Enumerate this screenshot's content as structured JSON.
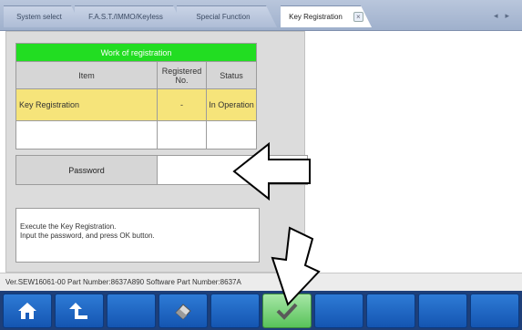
{
  "tabs": [
    {
      "label": "System select"
    },
    {
      "label": "F.A.S.T./IMMO/Keyless"
    },
    {
      "label": "Special Function"
    },
    {
      "label": "Key Registration",
      "close": "×"
    }
  ],
  "nav": {
    "prev": "◂",
    "next": "▸"
  },
  "work_table": {
    "title": "Work of registration",
    "headers": [
      "Item",
      "Registered No.",
      "Status"
    ],
    "rows": [
      {
        "item": "Key Registration",
        "registered_no": "-",
        "status": "In Operation"
      },
      {
        "item": "",
        "registered_no": "",
        "status": ""
      }
    ]
  },
  "password": {
    "label": "Password",
    "value": ""
  },
  "message": {
    "line1": "Execute the Key Registration.",
    "line2": "Input the password, and press OK button."
  },
  "status_bar": {
    "text": "Ver.SEW16061-00 Part Number:8637A890   Software Part Number:8637A"
  },
  "toolbar": {
    "buttons": [
      {
        "icon": "home-icon"
      },
      {
        "icon": "back-icon"
      },
      {
        "icon": ""
      },
      {
        "icon": "eraser-icon"
      },
      {
        "icon": ""
      },
      {
        "icon": "ok-check-icon"
      },
      {
        "icon": ""
      },
      {
        "icon": ""
      },
      {
        "icon": ""
      },
      {
        "icon": ""
      }
    ]
  },
  "colors": {
    "header_green": "#22dd22",
    "active_row_yellow": "#f6e47a",
    "toolbar_blue": "#1455b1",
    "ok_green": "#59c35a"
  }
}
